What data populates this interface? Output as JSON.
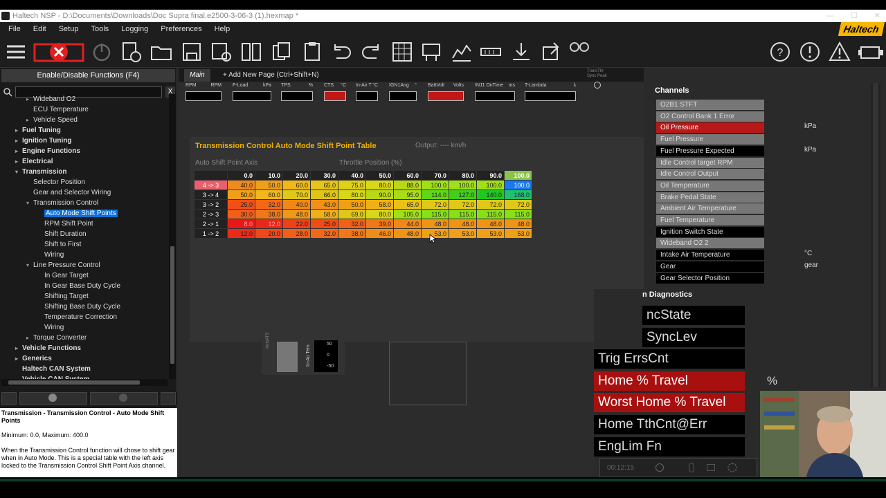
{
  "window": {
    "title": "Haltech NSP - D:\\Documents\\Downloads\\Doc Supra final.e2500-3-06-3 (1).hexmap *"
  },
  "menu": {
    "items": [
      "File",
      "Edit",
      "Setup",
      "Tools",
      "Logging",
      "Preferences",
      "Help"
    ],
    "brand": "Haltech"
  },
  "left": {
    "header": "Enable/Disable Functions (F4)",
    "search_close": "X",
    "tree": [
      {
        "label": "Wideband O2",
        "indent": 1,
        "arrow": "▸",
        "bold": false,
        "selected": false
      },
      {
        "label": "ECU Temperature",
        "indent": 1,
        "arrow": "",
        "bold": false,
        "selected": false
      },
      {
        "label": "Vehicle Speed",
        "indent": 1,
        "arrow": "▸",
        "bold": false,
        "selected": false
      },
      {
        "label": "Fuel Tuning",
        "indent": 0,
        "arrow": "▸",
        "bold": true,
        "selected": false
      },
      {
        "label": "Ignition Tuning",
        "indent": 0,
        "arrow": "▸",
        "bold": true,
        "selected": false
      },
      {
        "label": "Engine Functions",
        "indent": 0,
        "arrow": "▸",
        "bold": true,
        "selected": false
      },
      {
        "label": "Electrical",
        "indent": 0,
        "arrow": "▸",
        "bold": true,
        "selected": false
      },
      {
        "label": "Transmission",
        "indent": 0,
        "arrow": "▾",
        "bold": true,
        "selected": false
      },
      {
        "label": "Selector Position",
        "indent": 1,
        "arrow": "",
        "bold": false,
        "selected": false
      },
      {
        "label": "Gear and Selector Wiring",
        "indent": 1,
        "arrow": "",
        "bold": false,
        "selected": false
      },
      {
        "label": "Transmission Control",
        "indent": 1,
        "arrow": "▾",
        "bold": false,
        "selected": false
      },
      {
        "label": "Auto Mode Shift Points",
        "indent": 2,
        "arrow": "",
        "bold": false,
        "selected": true
      },
      {
        "label": "RPM Shift Point",
        "indent": 2,
        "arrow": "",
        "bold": false,
        "selected": false
      },
      {
        "label": "Shift Duration",
        "indent": 2,
        "arrow": "",
        "bold": false,
        "selected": false
      },
      {
        "label": "Shift to First",
        "indent": 2,
        "arrow": "",
        "bold": false,
        "selected": false
      },
      {
        "label": "Wiring",
        "indent": 2,
        "arrow": "",
        "bold": false,
        "selected": false
      },
      {
        "label": "Line Pressure Control",
        "indent": 1,
        "arrow": "▾",
        "bold": false,
        "selected": false
      },
      {
        "label": "In Gear Target",
        "indent": 2,
        "arrow": "",
        "bold": false,
        "selected": false
      },
      {
        "label": "In Gear Base Duty Cycle",
        "indent": 2,
        "arrow": "",
        "bold": false,
        "selected": false
      },
      {
        "label": "Shifting Target",
        "indent": 2,
        "arrow": "",
        "bold": false,
        "selected": false
      },
      {
        "label": "Shifting Base Duty Cycle",
        "indent": 2,
        "arrow": "",
        "bold": false,
        "selected": false
      },
      {
        "label": "Temperature Correction",
        "indent": 2,
        "arrow": "",
        "bold": false,
        "selected": false
      },
      {
        "label": "Wiring",
        "indent": 2,
        "arrow": "",
        "bold": false,
        "selected": false
      },
      {
        "label": "Torque Converter",
        "indent": 1,
        "arrow": "▸",
        "bold": false,
        "selected": false
      },
      {
        "label": "Vehicle Functions",
        "indent": 0,
        "arrow": "▸",
        "bold": true,
        "selected": false
      },
      {
        "label": "Generics",
        "indent": 0,
        "arrow": "▸",
        "bold": true,
        "selected": false
      },
      {
        "label": "Haltech CAN System",
        "indent": 0,
        "arrow": "",
        "bold": true,
        "selected": false
      },
      {
        "label": "Vehicle CAN System",
        "indent": 0,
        "arrow": "",
        "bold": true,
        "selected": false
      }
    ],
    "description": {
      "title": "Transmission - Transmission Control - Auto Mode Shift Points",
      "range": "Minimum: 0.0, Maximum: 400.0",
      "text": "When the Transmission Control function will chose to shift gear when in Auto Mode. This is a special table with the left axis locked to the Transmission Control Shift Point Axis channel."
    }
  },
  "tabs": [
    {
      "label": "Main",
      "active": true
    },
    {
      "label": "+ Add New Page (Ctrl+Shift+N)",
      "active": false
    }
  ],
  "gauges": [
    {
      "label": "RPM",
      "unit": "RPM",
      "red": false
    },
    {
      "label": "F-Load",
      "unit": "kPa",
      "red": false
    },
    {
      "label": "TPS",
      "unit": "%",
      "red": false
    },
    {
      "label": "CTS",
      "unit": "°C",
      "red": true
    },
    {
      "label": "In-Air T",
      "unit": "°C",
      "red": false
    },
    {
      "label": "IGN1Ang",
      "unit": "°",
      "red": false
    },
    {
      "label": "BattVolt",
      "unit": "Volts",
      "red": true
    },
    {
      "label": "INJ1 OnTime",
      "unit": "ms",
      "red": false
    },
    {
      "label": "T-Lambda",
      "unit": "λ",
      "red": false
    }
  ],
  "sync_label": "TransThr Sync Peak",
  "table": {
    "title": "Transmission Control Auto Mode Shift Point Table",
    "output": "Output: ---- km/h",
    "row_axis": "Auto Shift Point Axis",
    "col_axis": "Throttle Position (%)",
    "columns": [
      "0.0",
      "10.0",
      "20.0",
      "30.0",
      "40.0",
      "50.0",
      "60.0",
      "70.0",
      "80.0",
      "90.0",
      "100.0"
    ],
    "rows": [
      {
        "label": "4 -> 3",
        "values": [
          "40.0",
          "50.0",
          "60.0",
          "65.0",
          "75.0",
          "80.0",
          "88.0",
          "100.0",
          "100.0",
          "100.0",
          "100.0"
        ]
      },
      {
        "label": "3 -> 4",
        "values": [
          "50.0",
          "60.0",
          "70.0",
          "66.0",
          "80.0",
          "90.0",
          "95.0",
          "114.0",
          "127.0",
          "140.0",
          "168.0"
        ]
      },
      {
        "label": "3 -> 2",
        "values": [
          "25.0",
          "32.0",
          "40.0",
          "43.0",
          "50.0",
          "58.0",
          "65.0",
          "72.0",
          "72.0",
          "72.0",
          "72.0"
        ]
      },
      {
        "label": "2 -> 3",
        "values": [
          "30.0",
          "38.0",
          "48.0",
          "58.0",
          "69.0",
          "80.0",
          "105.0",
          "115.0",
          "115.0",
          "115.0",
          "115.0"
        ]
      },
      {
        "label": "2 -> 1",
        "values": [
          "8.0",
          "12.0",
          "22.0",
          "25.0",
          "32.0",
          "39.0",
          "44.0",
          "48.0",
          "48.0",
          "48.0",
          "48.0"
        ]
      },
      {
        "label": "1 -> 2",
        "values": [
          "12.0",
          "20.0",
          "28.0",
          "32.0",
          "38.0",
          "46.0",
          "48.0",
          "53.0",
          "53.0",
          "53.0",
          "53.0"
        ]
      }
    ],
    "colors": [
      [
        "#f08a1c",
        "#f0a018",
        "#f0b818",
        "#e8c418",
        "#e0d018",
        "#d8d818",
        "#b8d818",
        "#a0e018",
        "#a0e018",
        "#a0e018",
        "#1a78f0"
      ],
      [
        "#f0a018",
        "#f0b818",
        "#e0c818",
        "#e0c418",
        "#d8d818",
        "#b8d818",
        "#a8dc18",
        "#60d818",
        "#40d018",
        "#20c820",
        "#20c070"
      ],
      [
        "#f05018",
        "#f06818",
        "#f08818",
        "#f09018",
        "#f0a018",
        "#f0b018",
        "#e8c018",
        "#e0c818",
        "#e0c818",
        "#e0c818",
        "#e0c818"
      ],
      [
        "#f06018",
        "#f07818",
        "#f09818",
        "#f0b018",
        "#e0c818",
        "#d8d818",
        "#a0e018",
        "#88e018",
        "#88e018",
        "#88e018",
        "#88e018"
      ],
      [
        "#e81818",
        "#e82818",
        "#f04018",
        "#f04c18",
        "#f06018",
        "#f07818",
        "#f08818",
        "#f09418",
        "#f09418",
        "#f09418",
        "#f09418"
      ],
      [
        "#e82c18",
        "#f04818",
        "#f06018",
        "#f06818",
        "#f07818",
        "#f08c18",
        "#f09418",
        "#f0a018",
        "#f0a018",
        "#f0a018",
        "#f0a018"
      ]
    ]
  },
  "channels": {
    "header": "Channels",
    "items": [
      {
        "label": "O2B1 STFT",
        "style": "g",
        "unit": ""
      },
      {
        "label": "O2 Control Bank 1 Error",
        "style": "g",
        "unit": ""
      },
      {
        "label": "Oil Pressure",
        "style": "r",
        "unit": "kPa"
      },
      {
        "label": "Fuel Pressure",
        "style": "g",
        "unit": ""
      },
      {
        "label": "Fuel Pressure Expected",
        "style": "k",
        "unit": "kPa"
      },
      {
        "label": "Idle Control target RPM",
        "style": "g",
        "unit": ""
      },
      {
        "label": "Idle Control Output",
        "style": "g",
        "unit": ""
      },
      {
        "label": "Oil Temperature",
        "style": "g",
        "unit": ""
      },
      {
        "label": "Brake Pedal State",
        "style": "g",
        "unit": ""
      },
      {
        "label": "Ambient Air Temperature",
        "style": "g",
        "unit": ""
      },
      {
        "label": "Fuel Temperature",
        "style": "g",
        "unit": ""
      },
      {
        "label": "Ignition Switch State",
        "style": "k",
        "unit": ""
      },
      {
        "label": "Wideband O2 2",
        "style": "g",
        "unit": ""
      },
      {
        "label": "Intake Air Temperature",
        "style": "k",
        "unit": "°C"
      },
      {
        "label": "Gear",
        "style": "k",
        "unit": "gear"
      },
      {
        "label": "Gear Selector Position",
        "style": "k",
        "unit": ""
      }
    ]
  },
  "diagnostics": {
    "header": "n Diagnostics",
    "items": [
      {
        "label": "ncState",
        "style": "k",
        "unit": ""
      },
      {
        "label": "SyncLev",
        "style": "k",
        "unit": ""
      },
      {
        "label": "Trig ErrsCnt",
        "style": "k",
        "unit": ""
      },
      {
        "label": "Home % Travel",
        "style": "r",
        "unit": "%"
      },
      {
        "label": "Worst Home % Travel",
        "style": "r",
        "unit": ""
      },
      {
        "label": "Home TthCnt@Err",
        "style": "k",
        "unit": ""
      },
      {
        "label": "EngLim Fn",
        "style": "k",
        "unit": ""
      }
    ]
  },
  "clock": "00:12:15",
  "lower_gauge": {
    "label1": "AmbATS",
    "label2": "In-Air Tem",
    "ticks": [
      "50",
      "0",
      "-50"
    ]
  }
}
